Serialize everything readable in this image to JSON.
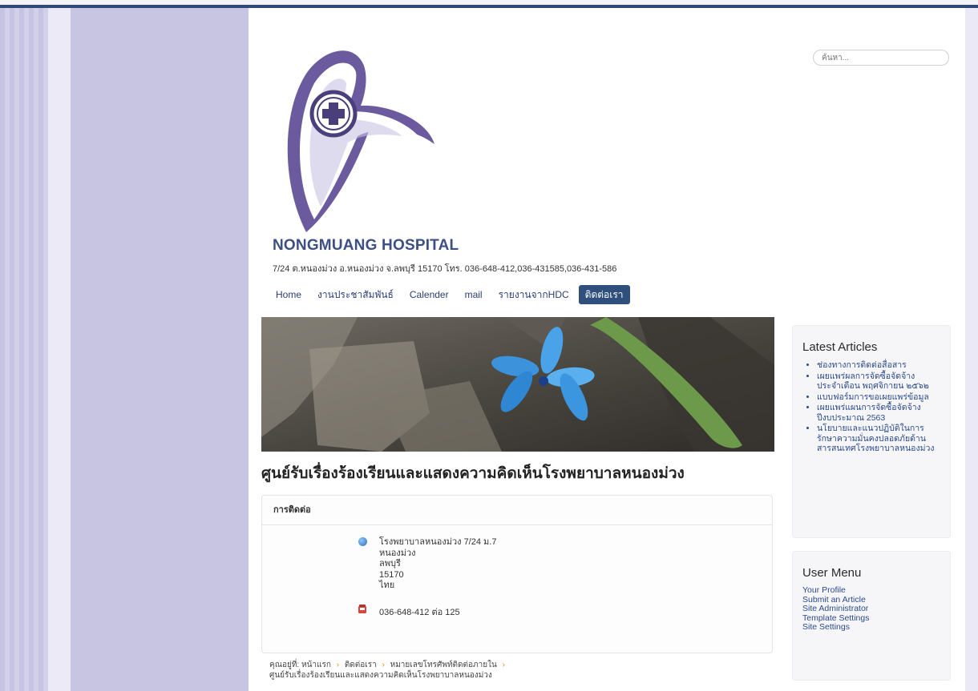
{
  "search": {
    "placeholder": "ค้นหา..."
  },
  "site": {
    "title": "NONGMUANG HOSPITAL",
    "address": "7/24 ต.หนองม่วง อ.หนองม่วง จ.ลพบุรี 15170 โทร. 036-648-412,036-431585,036-431-586"
  },
  "nav": {
    "items": [
      {
        "label": "Home"
      },
      {
        "label": "งานประชาสัมพันธ์"
      },
      {
        "label": "Calender"
      },
      {
        "label": "mail"
      },
      {
        "label": "รายงานจากHDC"
      },
      {
        "label": "ติดต่อเรา"
      }
    ],
    "active_index": 5
  },
  "main": {
    "heading": "ศูนย์รับเรื่องร้องเรียนและแสดงความคิดเห็นโรงพยาบาลหนองม่วง",
    "contact": {
      "header": "การติดต่อ",
      "name_line": "โรงพยาบาลหนองม่วง 7/24 ม.7",
      "district": "หนองม่วง",
      "province": "ลพบุรี",
      "postcode": "15170",
      "country": "ไทย",
      "phone": "036-648-412 ต่อ 125"
    }
  },
  "breadcrumb": {
    "prefix": "คุณอยู่ที่:",
    "items": [
      "หน้าแรก",
      "ติดต่อเรา",
      "หมายเลขโทรศัพท์ติดต่อภายใน"
    ],
    "current": "ศูนย์รับเรื่องร้องเรียนและแสดงความคิดเห็นโรงพยาบาลหนองม่วง"
  },
  "latest_articles": {
    "title": "Latest Articles",
    "items": [
      "ช่องทางการติดต่อสื่อสาร",
      "เผยแพร่ผลการจัดซื้อจัดจ้าง ประจำเดือน พฤศจิกายน ๒๕๖๒",
      "แบบฟอร์มการขอเผยแพร่ข้อมูล",
      "เผยแพร่แผนการจัดซื้อจัดจ้าง ปีงบประมาณ 2563",
      "นโยบายและแนวปฏิบัติในการรักษาความมั่นคงปลอดภัยด้านสารสนเทศโรงพยาบาลหนองม่วง"
    ]
  },
  "user_menu": {
    "title": "User Menu",
    "items": [
      "Your Profile",
      "Submit an Article",
      "Site Administrator",
      "Template Settings",
      "Site Settings"
    ]
  },
  "colors": {
    "nav_active_bg": "#2f4f7c",
    "title_color": "#3d4f86",
    "logo_purple": "#6b5a9e",
    "breadcrumb_separator": "#e58a1d"
  }
}
